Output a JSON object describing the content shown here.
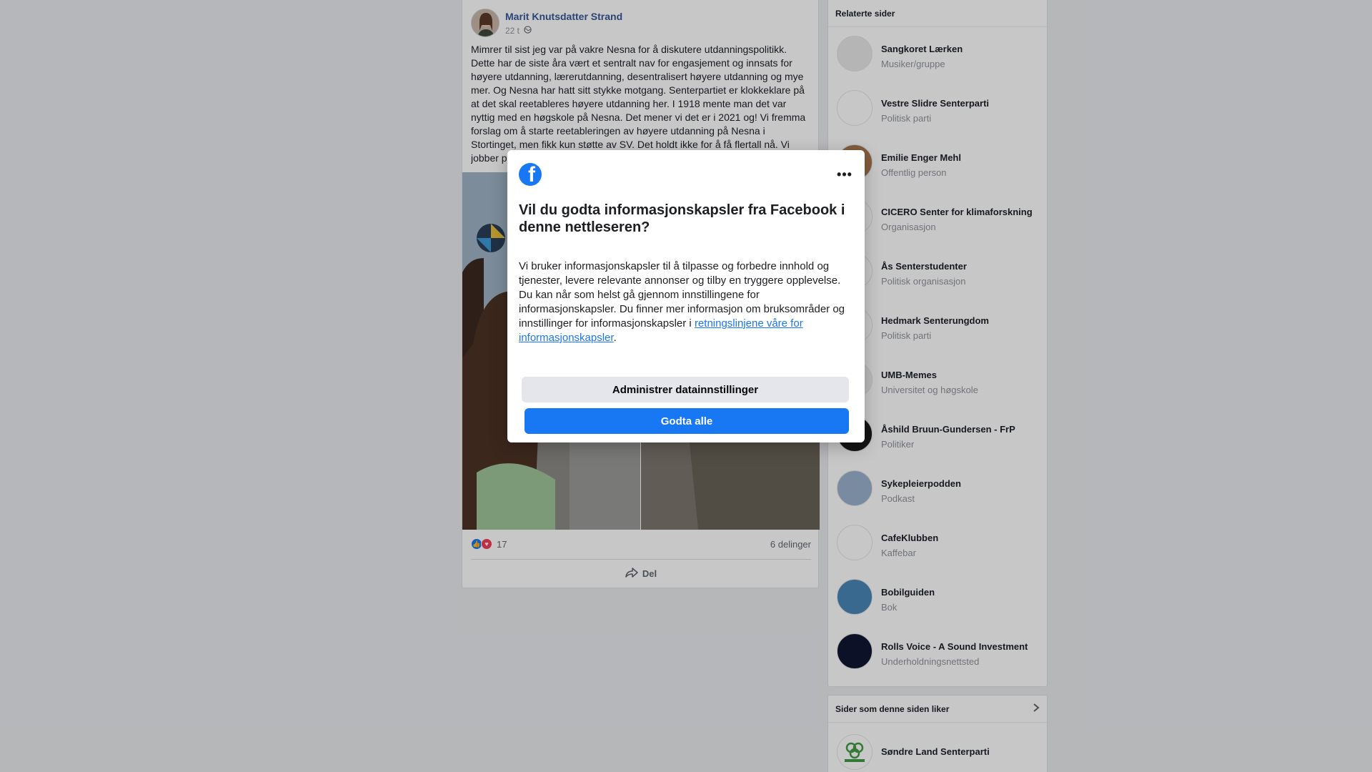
{
  "post": {
    "author": "Marit Knutsdatter Strand",
    "time": "22 t",
    "privacy_icon": "globe-icon",
    "text": "Mimrer til sist jeg var på vakre Nesna for å diskutere utdanningspolitikk. Dette har de siste åra vært et sentralt nav for engasjement og innsats for høyere utdanning, lærerutdanning, desentralisert høyere utdanning og mye mer. Og Nesna har hatt sitt stykke motgang. Senterpartiet er klokkeklare på at det skal reetableres høyere utdanning her. I 1918 mente man det var nyttig med en høgskole på Nesna. Det mener vi det er i 2021 og! Vi fremma forslag om å starte reetableringen av høyere utdanning på Nesna i Stortinget, men fikk kun støtte av SV. Det holdt ikke for å få flertall nå. Vi jobber på",
    "reaction_count": "17",
    "shares": "6 delinger",
    "share_label": "Del"
  },
  "sidebar": {
    "related_title": "Relaterte sider",
    "related": [
      {
        "name": "Sangkoret Lærken",
        "category": "Musiker/gruppe",
        "thumb_color": "#e8e8e8"
      },
      {
        "name": "Vestre Slidre Senterparti",
        "category": "Politisk parti",
        "thumb_color": "#ffffff"
      },
      {
        "name": "Emilie Enger Mehl",
        "category": "Offentlig person",
        "thumb_color": "#a9764f"
      },
      {
        "name": "CICERO Senter for klimaforskning",
        "category": "Organisasjon",
        "thumb_color": "#ffffff"
      },
      {
        "name": "Ås Senterstudenter",
        "category": "Politisk organisasjon",
        "thumb_color": "#ffffff"
      },
      {
        "name": "Hedmark Senterungdom",
        "category": "Politisk parti",
        "thumb_color": "#ffffff"
      },
      {
        "name": "UMB-Memes",
        "category": "Universitet og høgskole",
        "thumb_color": "#f0f0f0"
      },
      {
        "name": "Åshild Bruun-Gundersen - FrP",
        "category": "Politiker",
        "thumb_color": "#1a1a1a"
      },
      {
        "name": "Sykepleierpodden",
        "category": "Podkast",
        "thumb_color": "#9bb3cf"
      },
      {
        "name": "CafeKlubben",
        "category": "Kaffebar",
        "thumb_color": "#ffffff"
      },
      {
        "name": "Bobilguiden",
        "category": "Bok",
        "thumb_color": "#4a87b8"
      },
      {
        "name": "Rolls Voice - A Sound Investment",
        "category": "Underholdningsnettsted",
        "thumb_color": "#101733"
      }
    ],
    "liked_title": "Sider som denne siden liker",
    "liked": [
      {
        "name": "Søndre Land Senterparti"
      }
    ]
  },
  "dialog": {
    "logo_letter": "f",
    "more_label": "•••",
    "title": "Vil du godta informasjonskapsler fra Facebook i denne nettleseren?",
    "body": "Vi bruker informasjonskapsler til å tilpasse og forbedre innhold og tjenester, levere relevante annonser og tilby en tryggere opplevelse. Du kan når som helst gå gjennom innstillingene for informasjonskapsler. Du finner mer informasjon om bruksområder og innstillinger for informasjonskapsler i",
    "link": "retningslinjene våre for informasjonskapsler",
    "body_end": ".",
    "manage_button": "Administrer datainnstillinger",
    "accept_button": "Godta alle"
  },
  "colors": {
    "accent": "#1877f2",
    "author_link": "#385898",
    "page_bg": "#e9ebee"
  }
}
